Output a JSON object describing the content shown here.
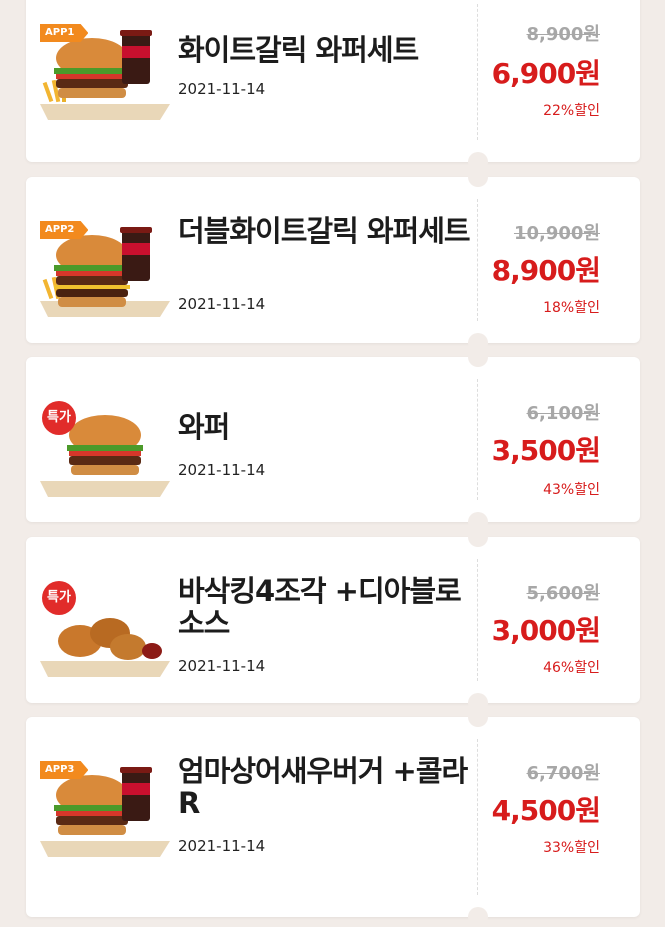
{
  "items": [
    {
      "badge_type": "app",
      "badge": "APP1",
      "title": "화이트갈릭 와퍼세트",
      "date": "2021-11-14",
      "original_price": "8,900원",
      "sale_price": "6,900원",
      "discount": "22%할인",
      "image": "whopper-set-image"
    },
    {
      "badge_type": "app",
      "badge": "APP2",
      "title": "더블화이트갈릭 와퍼세트",
      "date": "2021-11-14",
      "original_price": "10,900원",
      "sale_price": "8,900원",
      "discount": "18%할인",
      "image": "double-whopper-set-image"
    },
    {
      "badge_type": "sale",
      "badge": "특가",
      "title": "와퍼",
      "date": "2021-11-14",
      "original_price": "6,100원",
      "sale_price": "3,500원",
      "discount": "43%할인",
      "image": "whopper-image"
    },
    {
      "badge_type": "sale",
      "badge": "특가",
      "title": "바삭킹4조각 +디아블로소스",
      "date": "2021-11-14",
      "original_price": "5,600원",
      "sale_price": "3,000원",
      "discount": "46%할인",
      "image": "fried-chicken-image"
    },
    {
      "badge_type": "app",
      "badge": "APP3",
      "title": "엄마상어새우버거 +콜라R",
      "date": "2021-11-14",
      "original_price": "6,700원",
      "sale_price": "4,500원",
      "discount": "33%할인",
      "image": "shrimp-burger-set-image"
    }
  ],
  "colors": {
    "accent_red": "#d71c1c",
    "badge_orange": "#f28a1e",
    "sale_badge_red": "#e12c2a",
    "background": "#f2ece8"
  }
}
